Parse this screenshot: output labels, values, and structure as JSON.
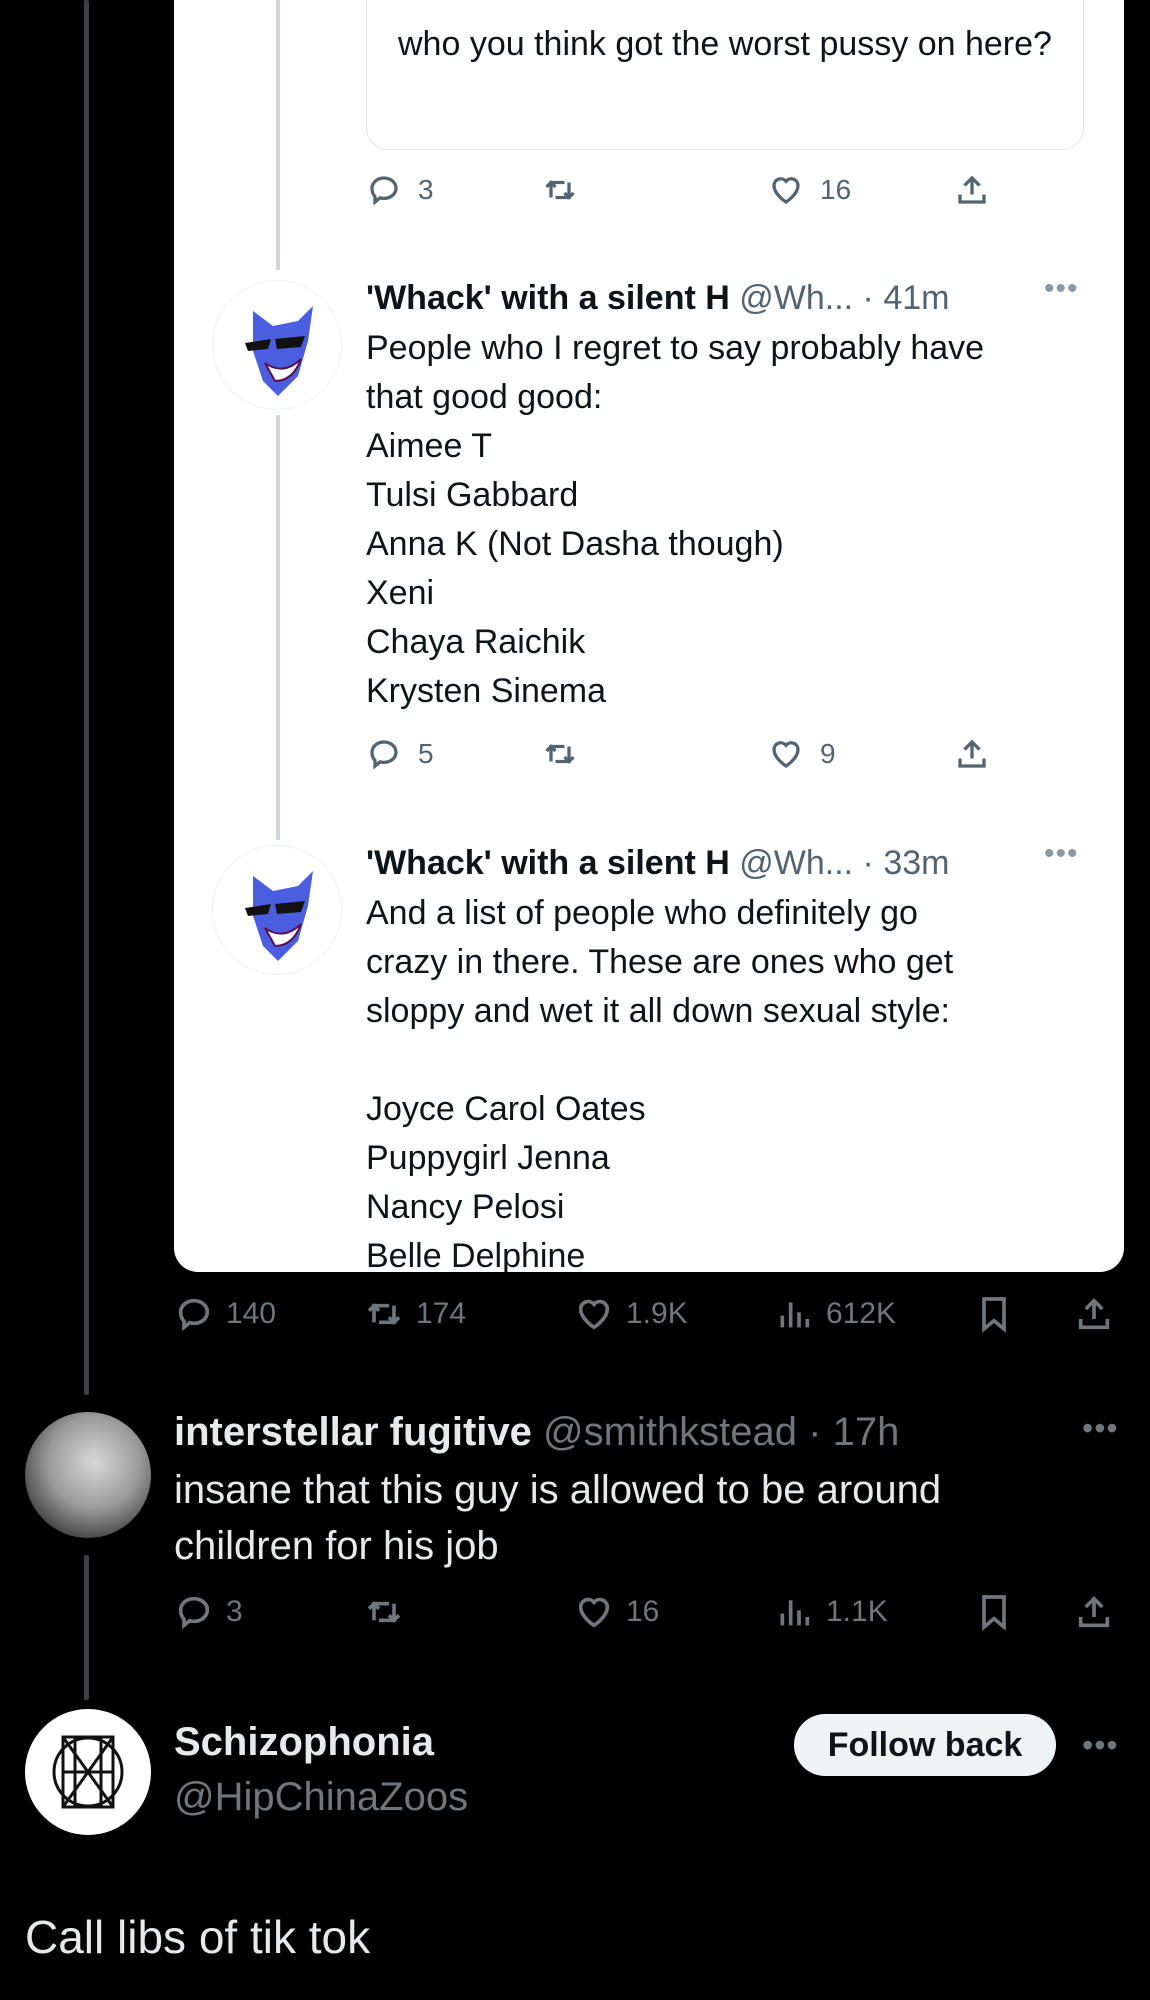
{
  "quoted_tweet": {
    "text": "who you think got the worst pussy on here?",
    "stats": {
      "replies": "3",
      "retweets": "",
      "likes": "16"
    }
  },
  "thread": [
    {
      "display_name": "'Whack' with a silent H",
      "handle_time": "@Wh... · 41m",
      "body_lines": [
        "People who I regret to say probably have",
        "that good good:",
        "Aimee T",
        "Tulsi Gabbard",
        "Anna K (Not Dasha though)",
        "Xeni",
        "Chaya Raichik",
        "Krysten Sinema"
      ],
      "stats": {
        "replies": "5",
        "retweets": "",
        "likes": "9"
      }
    },
    {
      "display_name": "'Whack' with a silent H",
      "handle_time": "@Wh... · 33m",
      "body_lines": [
        "And a list of people who definitely go",
        "crazy in there. These are ones who get",
        "sloppy and wet it all down sexual style:",
        "",
        "Joyce Carol Oates",
        "Puppygirl Jenna",
        "Nancy Pelosi",
        "Belle Delphine"
      ]
    }
  ],
  "main_stats": {
    "replies": "140",
    "retweets": "174",
    "likes": "1.9K",
    "views": "612K"
  },
  "reply": {
    "display_name": "interstellar fugitive",
    "handle_time": "@smithkstead · 17h",
    "body": "insane that this guy is allowed to be around children for his job",
    "stats": {
      "replies": "3",
      "retweets": "",
      "likes": "16",
      "views": "1.1K"
    }
  },
  "profile": {
    "display_name": "Schizophonia",
    "handle": "@HipChinaZoos",
    "follow_label": "Follow back",
    "text": "Call libs of tik tok"
  },
  "icons": {
    "reply": "speech-bubble-icon",
    "retweet": "retweet-arrows-icon",
    "like": "heart-icon",
    "views": "bar-chart-icon",
    "bookmark": "bookmark-icon",
    "share": "share-upload-icon",
    "more": "ellipsis-icon"
  },
  "colors": {
    "background": "#000000",
    "card": "#ffffff",
    "muted_dark": "#71767b",
    "muted_light": "#536471",
    "follow_button": "#eff3f4"
  }
}
